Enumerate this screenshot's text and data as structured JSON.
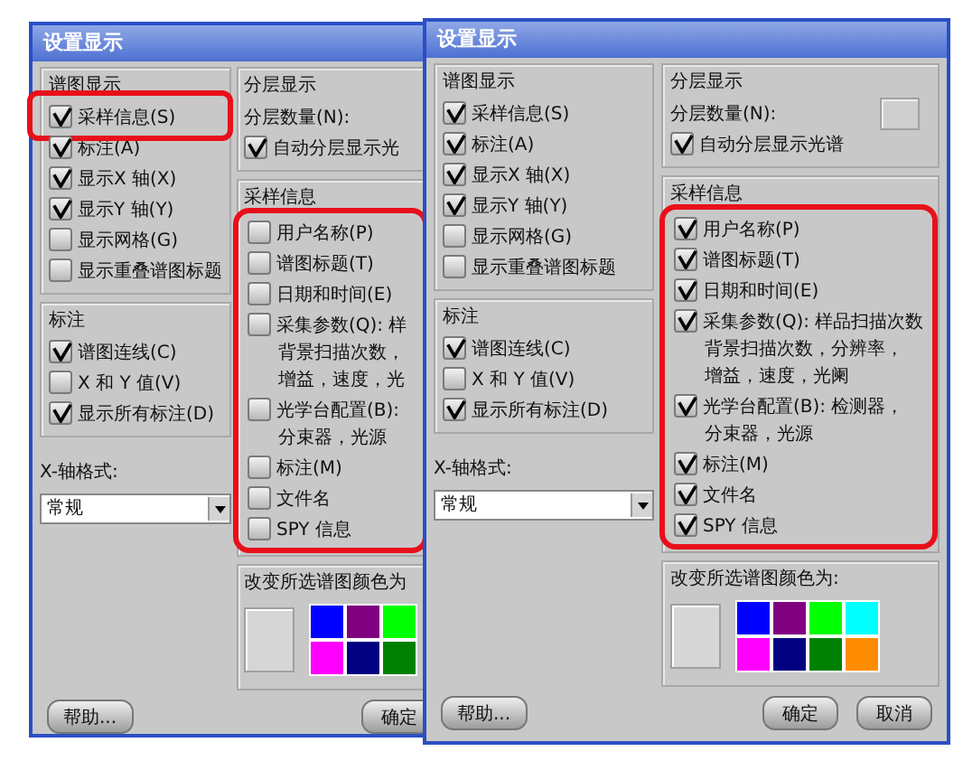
{
  "dialogs": [
    {
      "title": "设置显示",
      "display": {
        "title": "谱图显示",
        "items": [
          {
            "label": "采样信息(S)",
            "checked": true,
            "highlighted": true
          },
          {
            "label": "标注(A)",
            "checked": true
          },
          {
            "label": "显示X 轴(X)",
            "checked": true
          },
          {
            "label": "显示Y 轴(Y)",
            "checked": true
          },
          {
            "label": "显示网格(G)",
            "checked": false
          },
          {
            "label": "显示重叠谱图标题",
            "checked": false
          }
        ]
      },
      "labels": {
        "title": "标注",
        "items": [
          {
            "label": "谱图连线(C)",
            "checked": true
          },
          {
            "label": "X 和 Y 值(V)",
            "checked": false
          },
          {
            "label": "显示所有标注(D)",
            "checked": true
          }
        ]
      },
      "x_axis": {
        "label": "X-轴格式:",
        "value": "常规"
      },
      "layers": {
        "title": "分层显示",
        "count_label": "分层数量(N):",
        "auto": {
          "label": "自动分层显示光",
          "checked": true
        }
      },
      "sample_info": {
        "title": "采样信息",
        "highlighted": true,
        "items": [
          {
            "label": "用户名称(P)",
            "checked": false
          },
          {
            "label": "谱图标题(T)",
            "checked": false
          },
          {
            "label": "日期和时间(E)",
            "checked": false
          },
          {
            "label": "采集参数(Q): 样",
            "checked": false,
            "lines": [
              "背景扫描次数，",
              "增益，速度，光"
            ]
          },
          {
            "label": "光学台配置(B):",
            "checked": false,
            "lines": [
              "分束器，光源"
            ]
          },
          {
            "label": "标注(M)",
            "checked": false
          },
          {
            "label": "文件名",
            "checked": false
          },
          {
            "label": "SPY 信息",
            "checked": false
          }
        ]
      },
      "colors": {
        "label": "改变所选谱图颜色为",
        "swatches": [
          {
            "color": "#0000ff"
          },
          {
            "color": "#800080"
          },
          {
            "color": "#00ff00"
          },
          {
            "color": "#ff00ff"
          },
          {
            "color": "#000080"
          },
          {
            "color": "#008000"
          }
        ]
      },
      "buttons": [
        {
          "label": "帮助...",
          "kind": "help"
        },
        {
          "label": "确定",
          "kind": "ok"
        }
      ]
    },
    {
      "title": "设置显示",
      "display": {
        "title": "谱图显示",
        "items": [
          {
            "label": "采样信息(S)",
            "checked": true
          },
          {
            "label": "标注(A)",
            "checked": true
          },
          {
            "label": "显示X 轴(X)",
            "checked": true
          },
          {
            "label": "显示Y 轴(Y)",
            "checked": true
          },
          {
            "label": "显示网格(G)",
            "checked": false
          },
          {
            "label": "显示重叠谱图标题",
            "checked": false
          }
        ]
      },
      "labels": {
        "title": "标注",
        "items": [
          {
            "label": "谱图连线(C)",
            "checked": true
          },
          {
            "label": "X 和 Y 值(V)",
            "checked": false
          },
          {
            "label": "显示所有标注(D)",
            "checked": true
          }
        ]
      },
      "x_axis": {
        "label": "X-轴格式:",
        "value": "常规"
      },
      "layers": {
        "title": "分层显示",
        "count_label": "分层数量(N):",
        "count_field": {
          "disabled": true
        },
        "auto": {
          "label": "自动分层显示光谱",
          "checked": true
        }
      },
      "sample_info": {
        "title": "采样信息",
        "highlighted": true,
        "items": [
          {
            "label": "用户名称(P)",
            "checked": true
          },
          {
            "label": "谱图标题(T)",
            "checked": true
          },
          {
            "label": "日期和时间(E)",
            "checked": true
          },
          {
            "label": "采集参数(Q): 样品扫描次数",
            "checked": true,
            "lines": [
              "背景扫描次数，分辨率，",
              "增益，速度，光阑"
            ]
          },
          {
            "label": "光学台配置(B): 检测器，",
            "checked": true,
            "lines": [
              "分束器，光源"
            ]
          },
          {
            "label": "标注(M)",
            "checked": true
          },
          {
            "label": "文件名",
            "checked": true
          },
          {
            "label": "SPY 信息",
            "checked": true
          }
        ]
      },
      "colors": {
        "label": "改变所选谱图颜色为:",
        "swatches": [
          {
            "color": "#0000ff"
          },
          {
            "color": "#800080"
          },
          {
            "color": "#00ff00"
          },
          {
            "color": "#00ffff"
          },
          {
            "color": "#ff00ff"
          },
          {
            "color": "#000080"
          },
          {
            "color": "#008000"
          },
          {
            "color": "#ff8c00"
          }
        ]
      },
      "buttons": [
        {
          "label": "帮助...",
          "kind": "help"
        },
        {
          "label": "确定",
          "kind": "ok"
        },
        {
          "label": "取消",
          "kind": "cancel"
        }
      ]
    }
  ]
}
